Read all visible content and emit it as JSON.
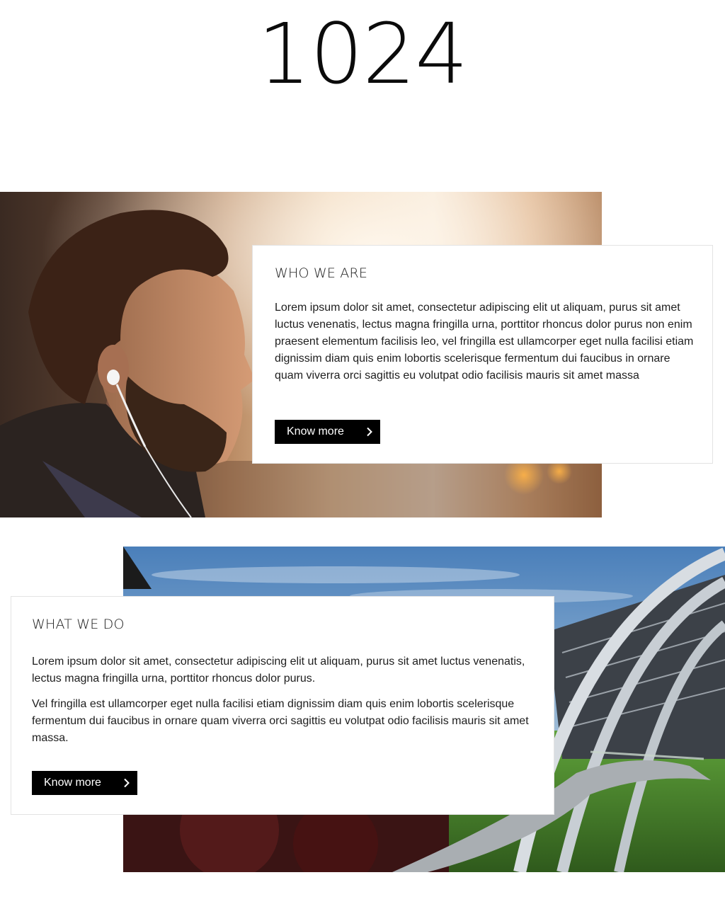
{
  "breakpoint": {
    "label": "1024"
  },
  "sections": [
    {
      "heading": "WHO WE ARE",
      "paragraphs": [
        "Lorem ipsum dolor sit amet, consectetur adipiscing elit ut aliquam, purus sit amet luctus venenatis, lectus magna fringilla urna, porttitor rhoncus dolor purus non enim praesent elementum facilisis leo, vel fringilla est ullamcorper eget nulla facilisi etiam dignissim diam quis enim lobortis scelerisque fermentum dui faucibus in ornare quam viverra orci sagittis eu volutpat odio facilisis mauris sit amet massa"
      ],
      "button": {
        "label": "Know more",
        "icon": "chevron-right-icon"
      },
      "image": "portrait-man-earphones"
    },
    {
      "heading": "WHAT WE DO",
      "paragraphs": [
        "Lorem ipsum dolor sit amet, consectetur adipiscing elit ut aliquam, purus sit amet luctus venenatis, lectus magna fringilla urna, porttitor rhoncus dolor purus.",
        "Vel fringilla est ullamcorper eget nulla facilisi etiam dignissim diam quis enim lobortis scelerisque fermentum dui faucibus in ornare quam viverra orci sagittis eu volutpat odio facilisis mauris sit amet massa."
      ],
      "button": {
        "label": "Know more",
        "icon": "chevron-right-icon"
      },
      "image": "modern-arched-building"
    }
  ],
  "colors": {
    "button_bg": "#000000",
    "button_text": "#ffffff",
    "card_border": "#e3e3e3",
    "text": "#1e1e1e"
  }
}
